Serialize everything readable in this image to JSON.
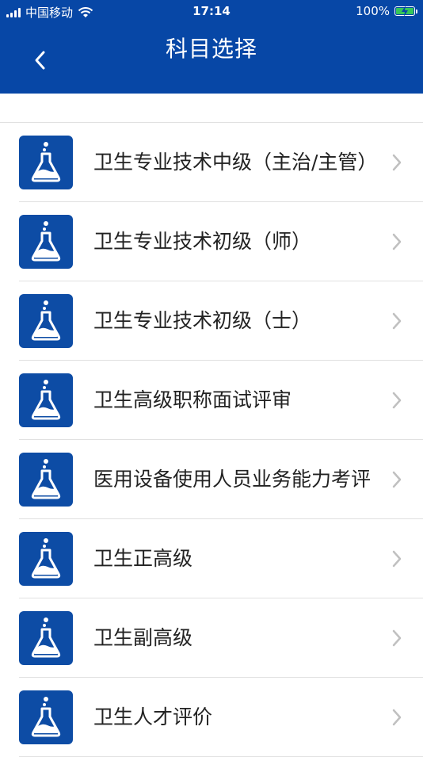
{
  "status_bar": {
    "carrier": "中国移动",
    "time": "17:14",
    "battery": "100%"
  },
  "header": {
    "title": "科目选择",
    "back_icon": "chevron-left-icon"
  },
  "colors": {
    "header_bg": "#0747a6",
    "icon_bg": "#0d4ca5",
    "text": "#222222",
    "chevron": "#c0c0c0"
  },
  "subjects": [
    {
      "label": "卫生专业技术中级（主治/主管）",
      "icon": "flask-icon"
    },
    {
      "label": "卫生专业技术初级（师）",
      "icon": "flask-icon"
    },
    {
      "label": "卫生专业技术初级（士）",
      "icon": "flask-icon"
    },
    {
      "label": "卫生高级职称面试评审",
      "icon": "flask-icon"
    },
    {
      "label": "医用设备使用人员业务能力考评",
      "icon": "flask-icon"
    },
    {
      "label": "卫生正高级",
      "icon": "flask-icon"
    },
    {
      "label": "卫生副高级",
      "icon": "flask-icon"
    },
    {
      "label": "卫生人才评价",
      "icon": "flask-icon"
    }
  ]
}
